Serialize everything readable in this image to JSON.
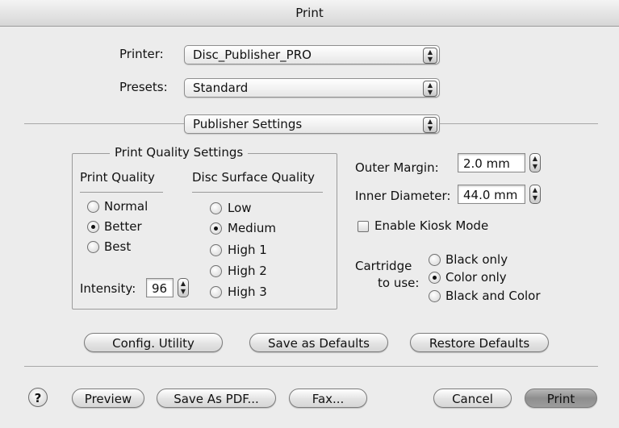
{
  "window": {
    "title": "Print"
  },
  "printer": {
    "label": "Printer:",
    "value": "Disc_Publisher_PRO"
  },
  "presets": {
    "label": "Presets:",
    "value": "Standard"
  },
  "panel": {
    "value": "Publisher Settings"
  },
  "quality_group": {
    "title": "Print Quality Settings",
    "print_quality": {
      "header": "Print Quality",
      "options": [
        "Normal",
        "Better",
        "Best"
      ],
      "selected": "Better"
    },
    "surface_quality": {
      "header": "Disc Surface Quality",
      "options": [
        "Low",
        "Medium",
        "High 1",
        "High 2",
        "High 3"
      ],
      "selected": "Medium"
    },
    "intensity": {
      "label": "Intensity:",
      "value": "96"
    }
  },
  "margins": {
    "outer_label": "Outer Margin:",
    "outer_value": "2.0 mm",
    "inner_label": "Inner Diameter:",
    "inner_value": "44.0 mm"
  },
  "kiosk": {
    "label": "Enable Kiosk Mode",
    "checked": false
  },
  "cartridge": {
    "label_line1": "Cartridge",
    "label_line2": "to use:",
    "options": [
      "Black only",
      "Color only",
      "Black and Color"
    ],
    "selected": "Color only"
  },
  "buttons": {
    "config": "Config. Utility",
    "save_defaults": "Save as Defaults",
    "restore_defaults": "Restore Defaults",
    "help": "?",
    "preview": "Preview",
    "save_pdf": "Save As PDF...",
    "fax": "Fax...",
    "cancel": "Cancel",
    "print": "Print"
  }
}
